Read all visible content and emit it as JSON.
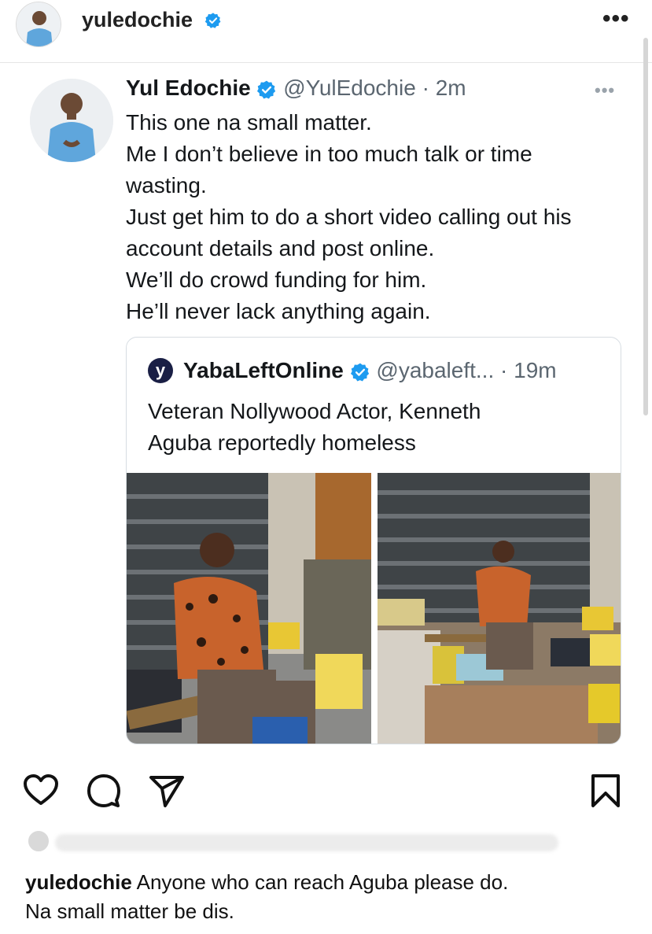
{
  "post": {
    "username": "yuledochie",
    "more_label": "•••"
  },
  "tweet": {
    "name": "Yul Edochie",
    "handle": "@YulEdochie",
    "time": "· 2m",
    "more_label": "•••",
    "lines": [
      "This one na small matter.",
      "Me I don’t believe in too much talk or time",
      "wasting.",
      "Just get him to do a short video calling out his",
      "account details and post online.",
      "We’ll do crowd funding for him.",
      "He’ll never lack anything again."
    ],
    "quote": {
      "logo_letter": "y",
      "name": "YabaLeftOnline",
      "handle": "@yabaleft...",
      "time": "· 19m",
      "lines": [
        "Veteran Nollywood Actor, Kenneth",
        "Aguba reportedly homeless"
      ]
    }
  },
  "caption": {
    "username": "yuledochie",
    "text_line1": "Anyone who can reach Aguba please do.",
    "text_line2": "Na small matter be dis."
  },
  "colors": {
    "verified": "#1d9bf0",
    "text": "#14171a",
    "muted": "#5b6670"
  }
}
